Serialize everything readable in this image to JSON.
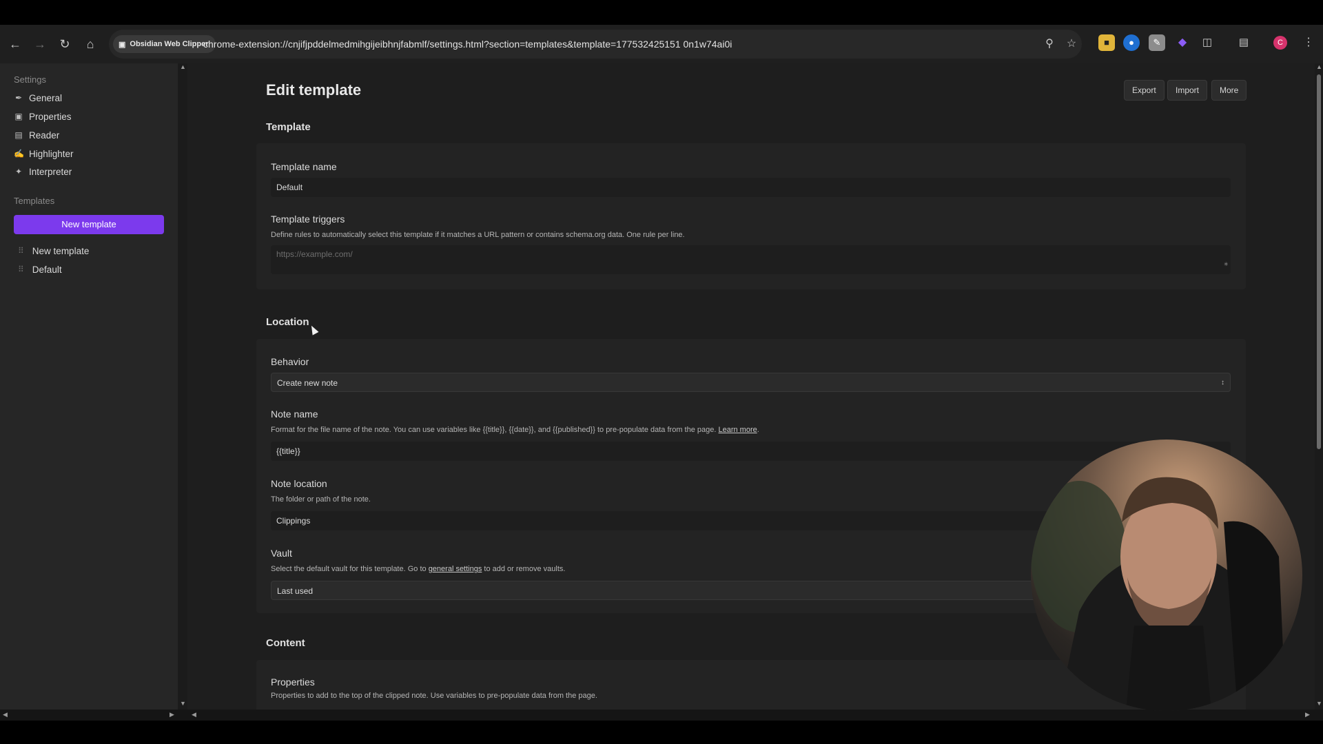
{
  "browser": {
    "site_chip": "Obsidian Web Clipper",
    "url": "chrome-extension://cnjifjpddelmedmihgijeibhnjfabmlf/settings.html?section=templates&template=177532425151 0n1w74ai0i",
    "profile_initial": "C"
  },
  "sidebar": {
    "settings_heading": "Settings",
    "settings_items": [
      {
        "label": "General",
        "icon": "paperclip-icon"
      },
      {
        "label": "Properties",
        "icon": "archive-icon"
      },
      {
        "label": "Reader",
        "icon": "book-icon"
      },
      {
        "label": "Highlighter",
        "icon": "highlighter-icon"
      },
      {
        "label": "Interpreter",
        "icon": "sparkles-icon"
      }
    ],
    "templates_heading": "Templates",
    "new_template_button": "New template",
    "templates": [
      {
        "label": "New template"
      },
      {
        "label": "Default"
      }
    ]
  },
  "main": {
    "page_title": "Edit template",
    "actions": {
      "export": "Export",
      "import": "Import",
      "more": "More"
    },
    "template_section": {
      "title": "Template",
      "name_label": "Template name",
      "name_value": "Default",
      "triggers_label": "Template triggers",
      "triggers_desc": "Define rules to automatically select this template if it matches a URL pattern or contains schema.org data. One rule per line.",
      "triggers_placeholder": "https://example.com/"
    },
    "location_section": {
      "title": "Location",
      "behavior_label": "Behavior",
      "behavior_value": "Create new note",
      "note_name_label": "Note name",
      "note_name_desc": "Format for the file name of the note. You can use variables like {{title}}, {{date}}, and {{published}} to pre-populate data from the page.",
      "note_name_link": "Learn more",
      "note_name_value": "{{title}}",
      "note_location_label": "Note location",
      "note_location_desc": "The folder or path of the note.",
      "note_location_value": "Clippings",
      "vault_label": "Vault",
      "vault_desc_pre": "Select the default vault for this template. Go to",
      "vault_desc_link": "general settings",
      "vault_desc_post": "to add or remove vaults.",
      "vault_value": "Last used"
    },
    "content_section": {
      "title": "Content",
      "properties_label": "Properties",
      "properties_desc": "Properties to add to the top of the clipped note. Use variables to pre-populate data from the page."
    }
  },
  "colors": {
    "accent": "#7c3aed",
    "background": "#1e1e1e",
    "sidebar": "#262626",
    "card": "#232323",
    "profile": "#d6336c"
  }
}
